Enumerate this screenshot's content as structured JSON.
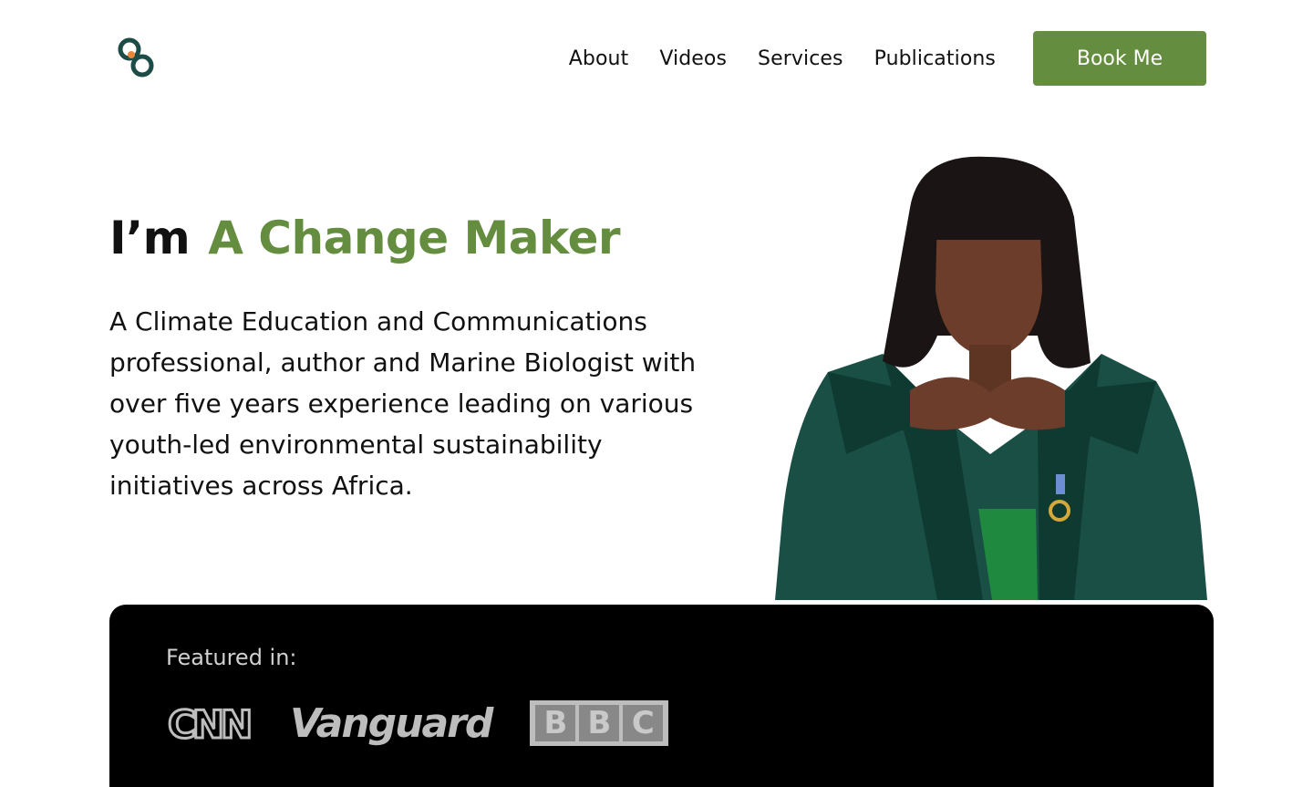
{
  "brand": {
    "logo_icon": "infinity-link-logo",
    "colors": {
      "primary_green": "#658d3f",
      "logo_dark": "#1d4b46",
      "logo_accent": "#e8873a"
    }
  },
  "nav": {
    "items": [
      {
        "label": "About"
      },
      {
        "label": "Videos"
      },
      {
        "label": "Services"
      },
      {
        "label": "Publications"
      }
    ],
    "cta_label": "Book Me"
  },
  "hero": {
    "headline_prefix": "I’m",
    "headline_accent": "A Change Maker",
    "description": "A Climate Education and Communications professional, author and Marine Biologist with over five years experience leading on various youth-led environmental sustainability initiatives across Africa."
  },
  "featured": {
    "label": "Featured in:",
    "outlets": [
      {
        "name": "CNN",
        "icon": "cnn-logo"
      },
      {
        "name": "Vanguard",
        "icon": "vanguard-logo"
      },
      {
        "name": "BBC",
        "letters": [
          "B",
          "B",
          "C"
        ]
      }
    ]
  }
}
